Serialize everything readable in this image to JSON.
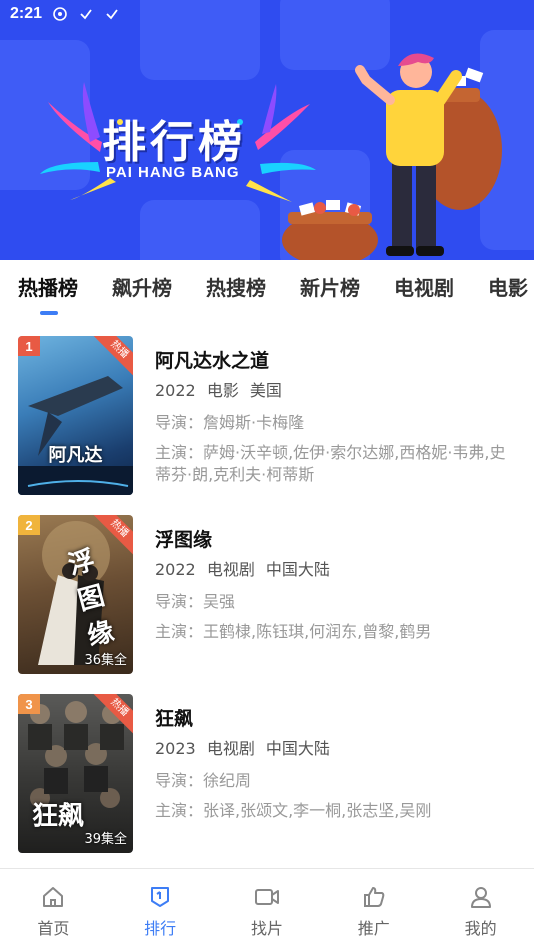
{
  "status_bar": {
    "time": "2:21"
  },
  "banner": {
    "title": "排行榜",
    "subtitle": "PAI HANG BANG"
  },
  "tabs": [
    {
      "label": "热播榜",
      "active": true
    },
    {
      "label": "飙升榜"
    },
    {
      "label": "热搜榜"
    },
    {
      "label": "新片榜"
    },
    {
      "label": "电视剧"
    },
    {
      "label": "电影"
    }
  ],
  "items": [
    {
      "rank": "1",
      "rank_color": "#e85a44",
      "hot_label": "热播",
      "title": "阿凡达水之道",
      "year": "2022",
      "category": "电影",
      "region": "美国",
      "director": "导演：詹姆斯·卡梅隆",
      "actors": "主演：萨姆·沃辛顿,佐伊·索尔达娜,西格妮·韦弗,史蒂芬·朗,克利夫·柯蒂斯",
      "poster_episodes": "",
      "poster_art": "阿凡达"
    },
    {
      "rank": "2",
      "rank_color": "#f0b43c",
      "hot_label": "热播",
      "title": "浮图缘",
      "year": "2022",
      "category": "电视剧",
      "region": "中国大陆",
      "director": "导演：吴强",
      "actors": "主演：王鹤棣,陈钰琪,何润东,曾黎,鹤男",
      "poster_episodes": "36集全",
      "poster_art": "浮图缘"
    },
    {
      "rank": "3",
      "rank_color": "#f0944a",
      "hot_label": "热播",
      "title": "狂飙",
      "year": "2023",
      "category": "电视剧",
      "region": "中国大陆",
      "director": "导演：徐纪周",
      "actors": "主演：张译,张颂文,李一桐,张志坚,吴刚",
      "poster_episodes": "39集全",
      "poster_art": "狂飙"
    }
  ],
  "bottom_nav": [
    {
      "label": "首页",
      "icon": "home-icon"
    },
    {
      "label": "排行",
      "icon": "ranking-icon",
      "active": true
    },
    {
      "label": "找片",
      "icon": "video-icon"
    },
    {
      "label": "推广",
      "icon": "thumb-up-icon"
    },
    {
      "label": "我的",
      "icon": "user-icon"
    }
  ],
  "colors": {
    "accent": "#3d7df5",
    "banner_bg": "#2f4cf0",
    "hot": "#e85a44"
  }
}
